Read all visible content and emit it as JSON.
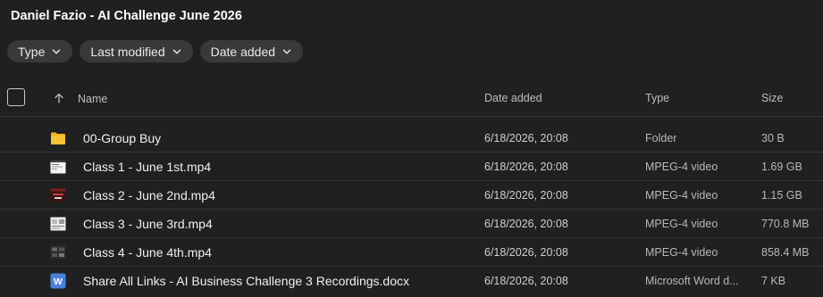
{
  "title": "Daniel Fazio - AI Challenge June 2026",
  "filters": [
    {
      "label": "Type",
      "icon": "chevron-down-icon"
    },
    {
      "label": "Last modified",
      "icon": "chevron-down-icon"
    },
    {
      "label": "Date added",
      "icon": "chevron-down-icon"
    }
  ],
  "columns": {
    "name": "Name",
    "date_added": "Date added",
    "type": "Type",
    "size": "Size"
  },
  "colors": {
    "background": "#1f2020",
    "chip": "#383939",
    "folder": "#f6b419",
    "word": "#4a7fe0"
  },
  "files": [
    {
      "icon": "folder-icon",
      "name": "00-Group Buy",
      "date_added": "6/18/2026, 20:08",
      "type": "Folder",
      "size": "30 B"
    },
    {
      "icon": "video-thumbnail-icon",
      "name": "Class 1 - June 1st.mp4",
      "date_added": "6/18/2026, 20:08",
      "type": "MPEG-4 video",
      "size": "1.69 GB"
    },
    {
      "icon": "video-thumbnail-icon",
      "name": "Class 2 - June 2nd.mp4",
      "date_added": "6/18/2026, 20:08",
      "type": "MPEG-4 video",
      "size": "1.15 GB"
    },
    {
      "icon": "video-thumbnail-icon",
      "name": "Class 3 - June 3rd.mp4",
      "date_added": "6/18/2026, 20:08",
      "type": "MPEG-4 video",
      "size": "770.8 MB"
    },
    {
      "icon": "video-thumbnail-icon",
      "name": "Class 4 - June 4th.mp4",
      "date_added": "6/18/2026, 20:08",
      "type": "MPEG-4 video",
      "size": "858.4 MB"
    },
    {
      "icon": "word-document-icon",
      "name": "Share All Links - AI Business Challenge 3 Recordings.docx",
      "date_added": "6/18/2026, 20:08",
      "type": "Microsoft Word d...",
      "size": "7 KB"
    }
  ]
}
